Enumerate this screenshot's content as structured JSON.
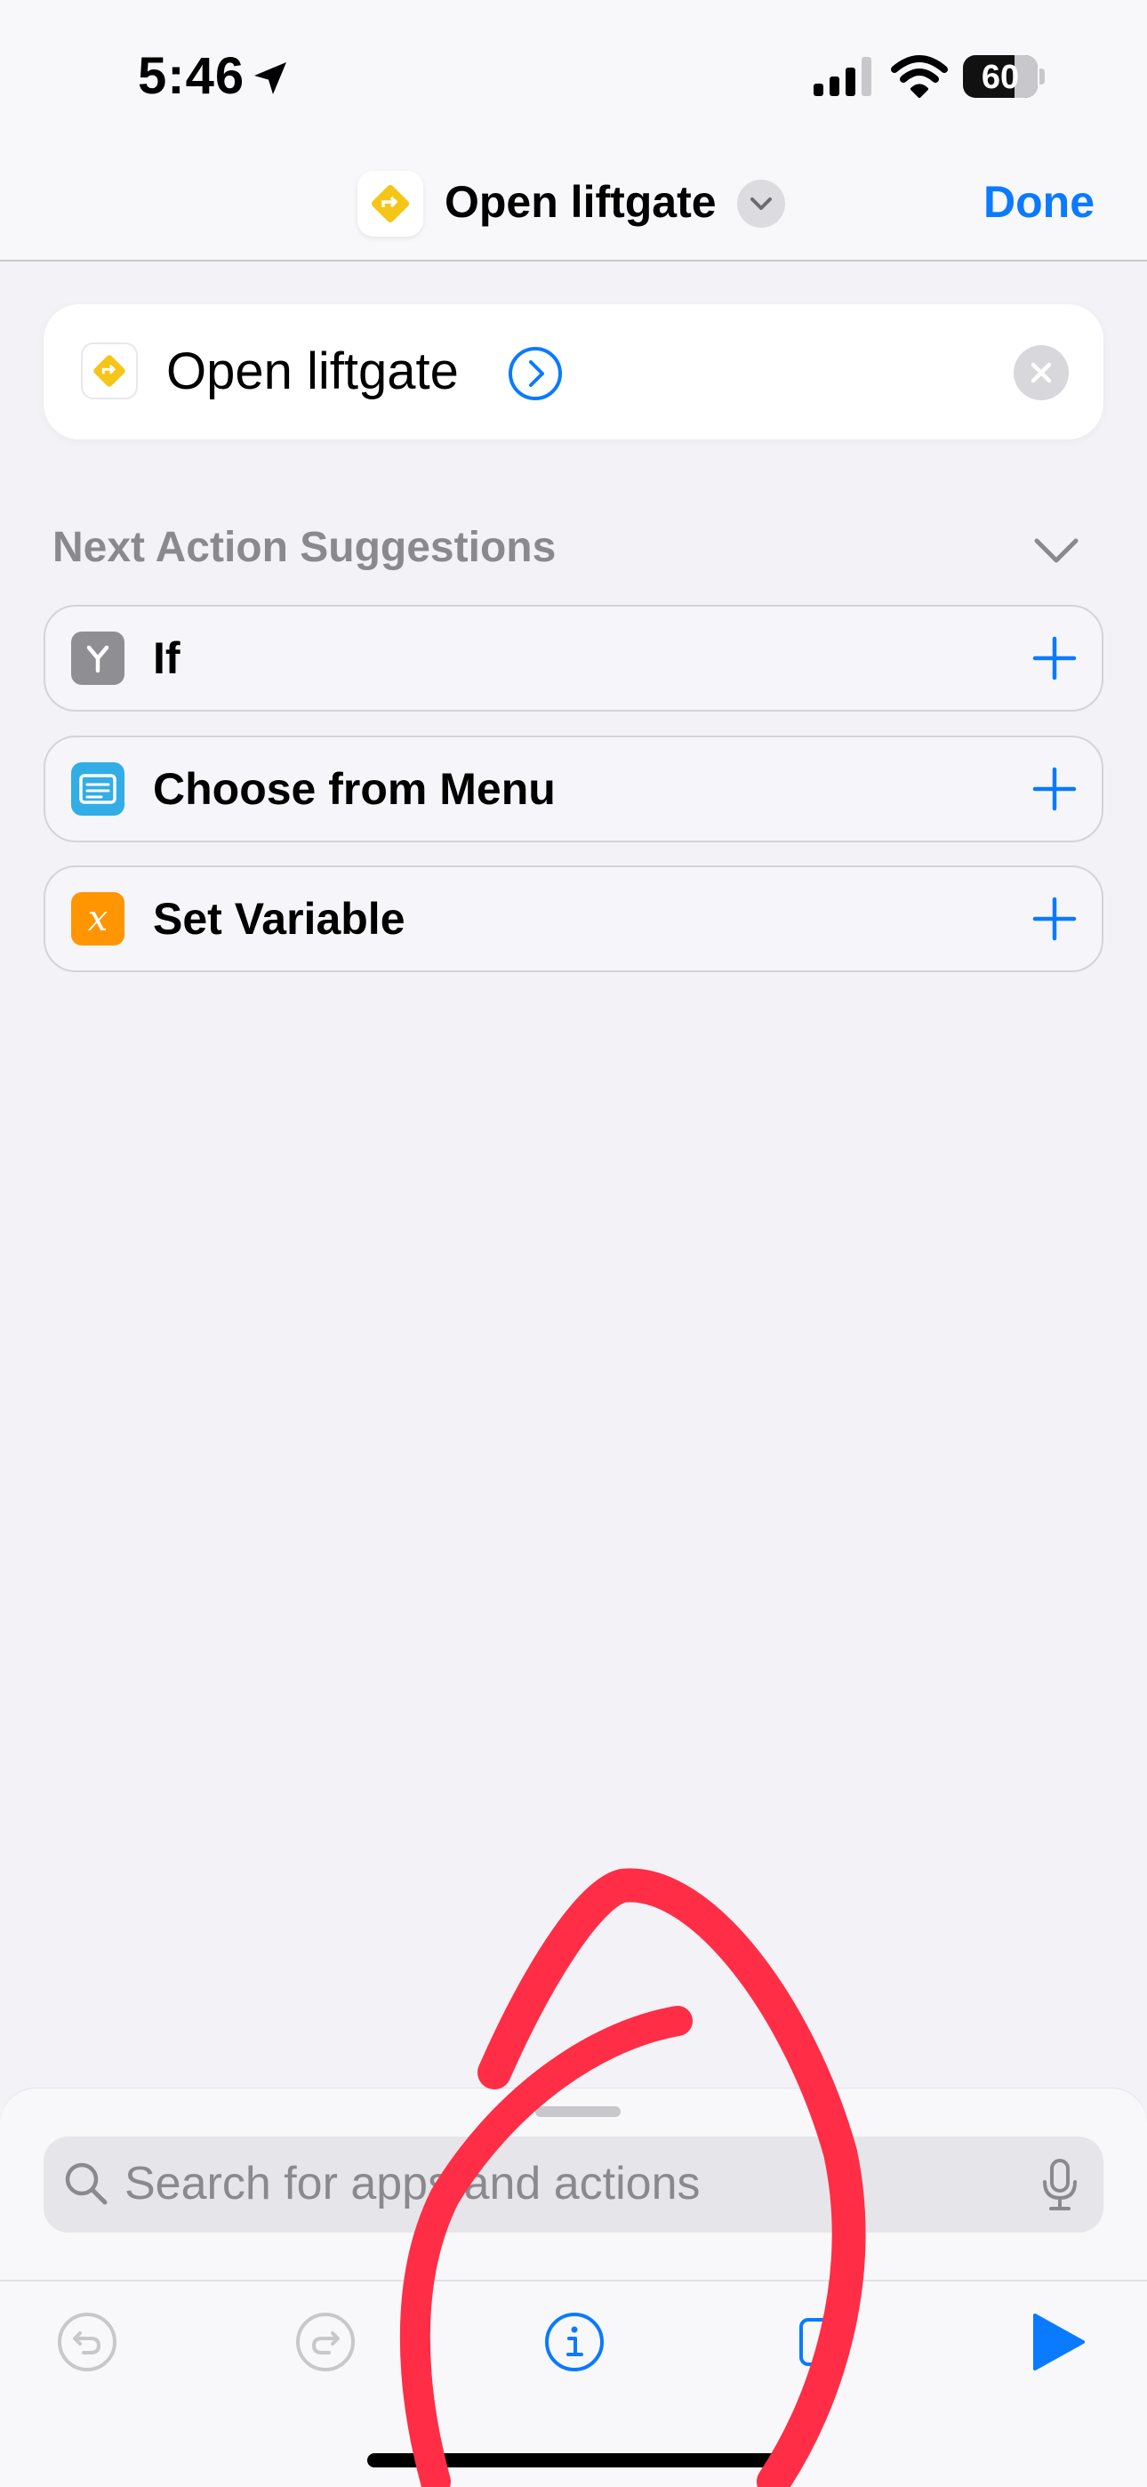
{
  "status_bar": {
    "time": "5:46",
    "battery_percent": "60",
    "icons": [
      "location-arrow-icon",
      "cellular-signal-icon",
      "wifi-icon",
      "battery-icon"
    ]
  },
  "nav": {
    "title": "Open liftgate",
    "done_label": "Done",
    "app_icon": "diamond-direction-icon",
    "accent_color": "#0a7aff"
  },
  "action": {
    "title": "Open liftgate",
    "icon": "diamond-direction-icon",
    "icon_color": "#f5c518"
  },
  "suggestions": {
    "header": "Next Action Suggestions",
    "items": [
      {
        "label": "If",
        "icon": "branch-icon",
        "color": "#8e8e93"
      },
      {
        "label": "Choose from Menu",
        "icon": "menu-list-icon",
        "color": "#32ade6"
      },
      {
        "label": "Set Variable",
        "icon": "variable-x-icon",
        "glyph": "x",
        "color": "#ff9500"
      }
    ]
  },
  "search": {
    "placeholder": "Search for apps and actions"
  },
  "toolbar": {
    "buttons": [
      "undo-icon",
      "redo-icon",
      "info-icon",
      "settings-square-icon",
      "play-icon"
    ]
  },
  "annotation": {
    "color": "#ff2d46",
    "shape": "hand-drawn circle"
  }
}
